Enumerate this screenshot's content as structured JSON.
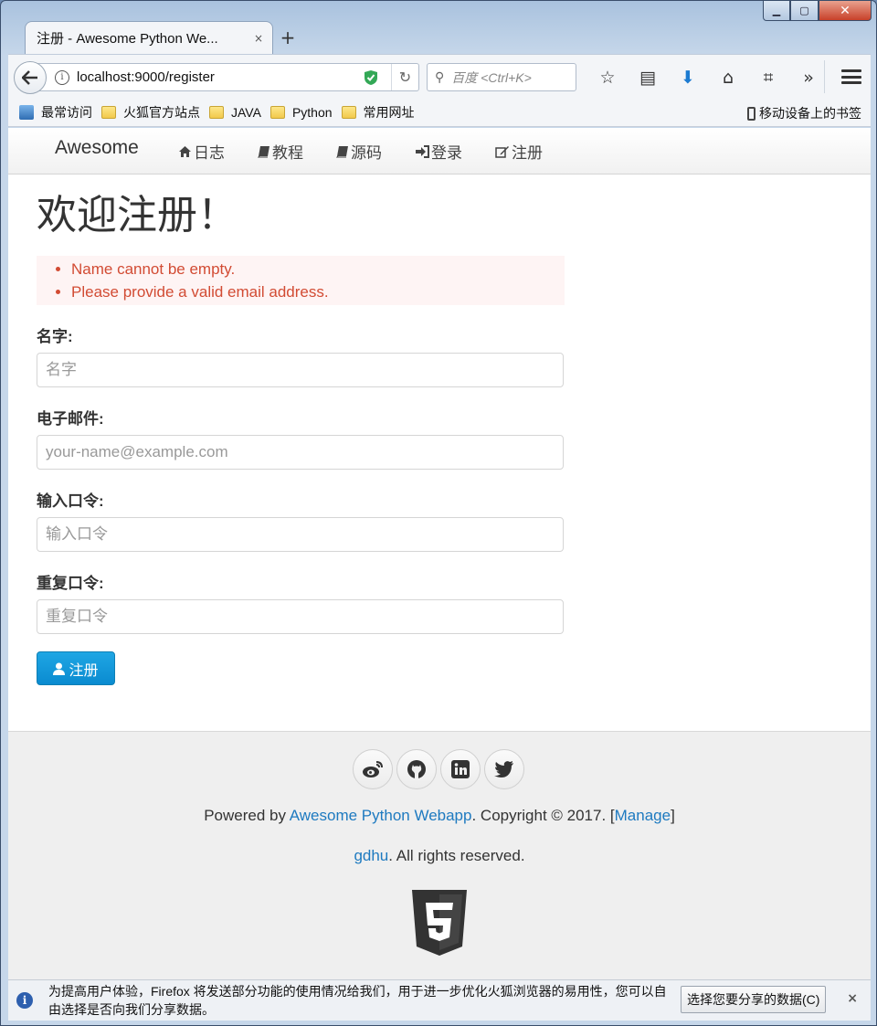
{
  "browser": {
    "tab_title": "注册 - Awesome Python We...",
    "tab_close": "×",
    "new_tab": "+",
    "url": "localhost:9000/register",
    "search_placeholder": "百度 <Ctrl+K>",
    "toolbar_icons": [
      "bookmark-star-icon",
      "reading-list-icon",
      "download-icon",
      "home-icon",
      "screenshot-crop-icon",
      "overflow-chevrons-icon",
      "menu-icon"
    ],
    "bookmarks": [
      {
        "label": "最常访问",
        "icon": "most-visited-icon"
      },
      {
        "label": "火狐官方站点",
        "icon": "folder-icon"
      },
      {
        "label": "JAVA",
        "icon": "folder-icon"
      },
      {
        "label": "Python",
        "icon": "folder-icon"
      },
      {
        "label": "常用网址",
        "icon": "folder-icon"
      }
    ],
    "mobile_bookmarks": "移动设备上的书签"
  },
  "site": {
    "brand": "Awesome",
    "menu": [
      {
        "label": "日志",
        "icon": "home-icon"
      },
      {
        "label": "教程",
        "icon": "book-icon"
      },
      {
        "label": "源码",
        "icon": "book-icon"
      },
      {
        "label": "登录",
        "icon": "sign-in-icon"
      },
      {
        "label": "注册",
        "icon": "edit-icon"
      }
    ]
  },
  "form": {
    "title": "欢迎注册！",
    "errors": [
      "Name cannot be empty.",
      "Please provide a valid email address."
    ],
    "fields": [
      {
        "label": "名字:",
        "placeholder": "名字",
        "value": ""
      },
      {
        "label": "电子邮件:",
        "placeholder": "your-name@example.com",
        "value": ""
      },
      {
        "label": "输入口令:",
        "placeholder": "输入口令",
        "value": ""
      },
      {
        "label": "重复口令:",
        "placeholder": "重复口令",
        "value": ""
      }
    ],
    "submit_label": "注册"
  },
  "footer": {
    "social": [
      "weibo-icon",
      "github-icon",
      "linkedin-icon",
      "twitter-icon"
    ],
    "powered_prefix": "Powered by ",
    "powered_link": "Awesome Python Webapp",
    "copyright_mid": ". Copyright © 2017. [",
    "manage_link": "Manage",
    "copyright_end": "]",
    "author_link": "gdhu",
    "rights_text": ". All rights reserved."
  },
  "notification": {
    "text": "为提高用户体验，Firefox 将发送部分功能的使用情况给我们，用于进一步优化火狐浏览器的易用性，您可以自由选择是否向我们分享数据。",
    "button": "选择您要分享的数据(C)",
    "close": "×"
  },
  "colors": {
    "accent": "#1e7ac0",
    "error": "#d24b33",
    "primary_button": "#1fa6e4"
  }
}
